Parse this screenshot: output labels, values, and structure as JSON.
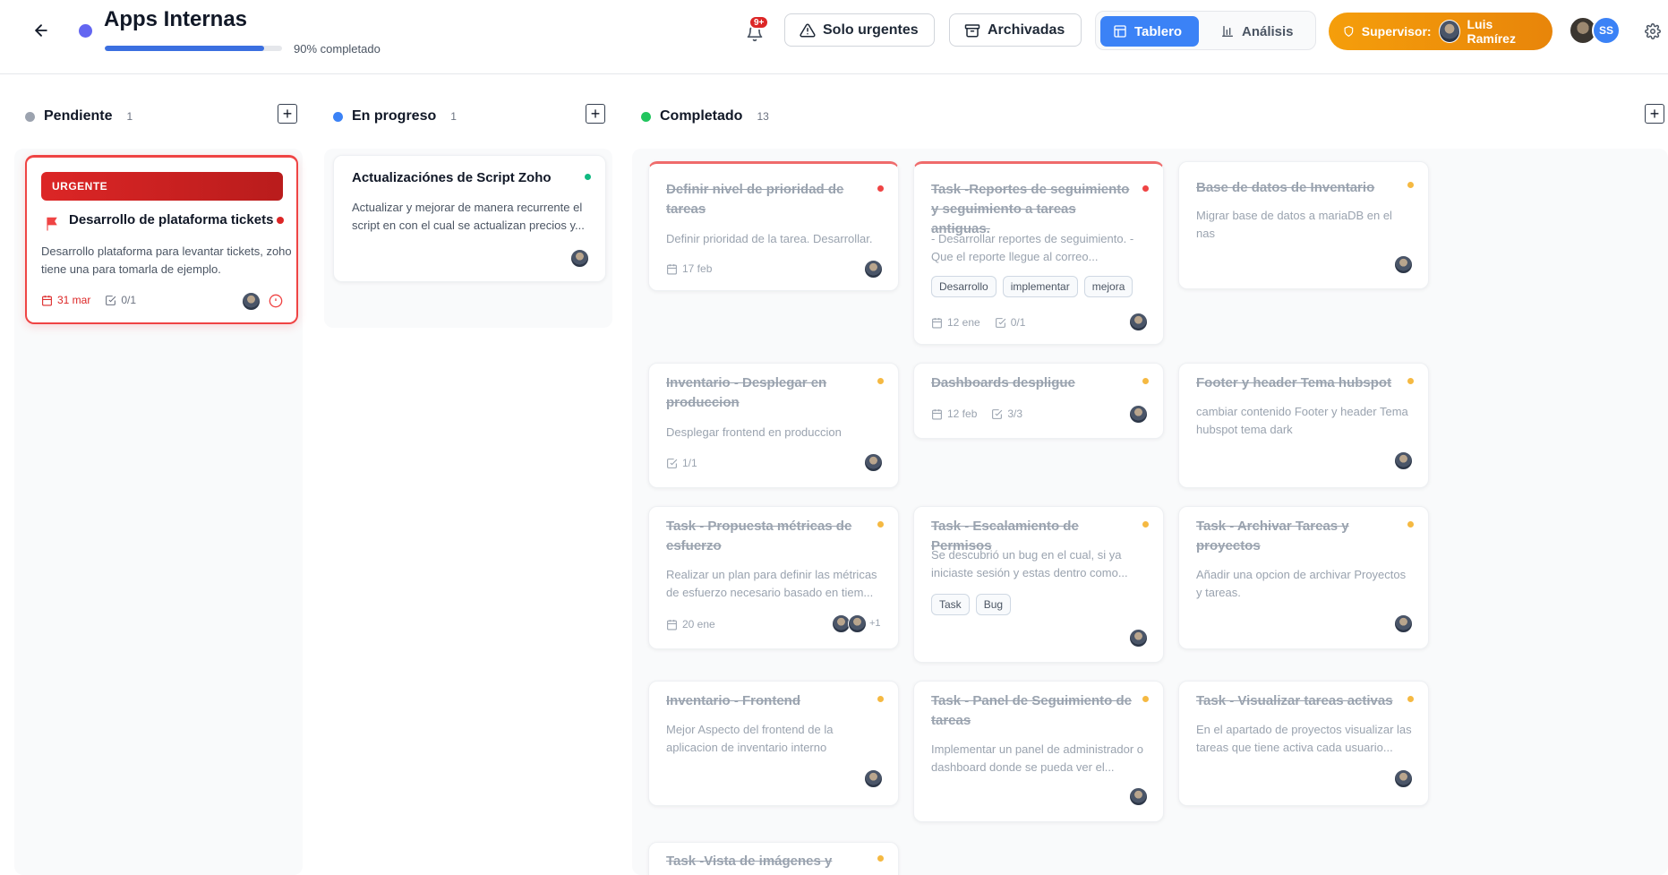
{
  "header": {
    "project_title": "Apps Internas",
    "project_color": "#6366f1",
    "progress_text": "90% completado",
    "progress_value": 0.9,
    "notifications_badge": "9+",
    "urgent_only_label": "Solo urgentes",
    "archived_label": "Archivadas",
    "view_board_label": "Tablero",
    "view_analysis_label": "Análisis",
    "supervisor_label": "Supervisor:",
    "supervisor_name": "Luis Ramírez",
    "team_initials": "SS"
  },
  "columns": {
    "pending": {
      "title": "Pendiente",
      "count": "1",
      "color": "#9ca3af"
    },
    "in_progress": {
      "title": "En progreso",
      "count": "1",
      "color": "#3b82f6"
    },
    "completed": {
      "title": "Completado",
      "count": "13",
      "color": "#22c55e"
    }
  },
  "pending_cards": [
    {
      "badge": "URGENTE",
      "title": "Desarrollo de plataforma tickets",
      "description": "Desarrollo plataforma para levantar tickets, zoho tiene una para tomarla de ejemplo.",
      "date": "31 mar",
      "checklist": "0/1"
    }
  ],
  "in_progress_cards": [
    {
      "title": "Actualizaciónes de Script Zoho",
      "description": "Actualizar y mejorar de manera recurrente el script en con el cual se actualizan precios y..."
    }
  ],
  "completed_cards": [
    {
      "title": "Definir nivel de prioridad de tareas",
      "description": "Definir prioridad de la tarea. Desarrollar.",
      "date": "17 feb"
    },
    {
      "title": "Task -Reportes de seguimiento y seguimiento a tareas antiguas.",
      "description": "- Desarrollar reportes de seguimiento. - Que el reporte llegue al correo...",
      "tags": [
        "Desarrollo",
        "implementar",
        "mejora"
      ],
      "date": "12 ene",
      "checklist": "0/1"
    },
    {
      "title": "Base de datos de Inventario",
      "description": "Migrar base de datos a mariaDB en el nas"
    },
    {
      "title": "Inventario - Desplegar en produccion",
      "description": "Desplegar frontend en produccion",
      "checklist": "1/1"
    },
    {
      "title": "Dashboards despligue",
      "date": "12 feb",
      "checklist": "3/3"
    },
    {
      "title": "Footer y header Tema hubspot",
      "description": "cambiar contenido Footer y header Tema hubspot tema dark"
    },
    {
      "title": "Task - Propuesta métricas de esfuerzo",
      "description": "Realizar un plan para definir las métricas de esfuerzo necesario basado en tiem...",
      "date": "20 ene",
      "extra_assignees": "+1"
    },
    {
      "title": "Task - Escalamiento de Permisos",
      "description": "Se descubrió un bug en el cual, si ya iniciaste sesión y estas dentro como...",
      "tags": [
        "Task",
        "Bug"
      ]
    },
    {
      "title": "Task - Archivar Tareas y proyectos",
      "description": "Añadir una opcion de archivar Proyectos y tareas."
    },
    {
      "title": "Inventario - Frontend",
      "description": "Mejor Aspecto del frontend de la aplicacion de inventario interno"
    },
    {
      "title": "Task - Panel de Seguimiento de tareas",
      "description": "Implementar un panel de administrador o dashboard donde se pueda ver el..."
    },
    {
      "title": "Task - Visualizar tareas activas",
      "description": "En el apartado de proyectos visualizar las tareas que tiene activa cada usuario..."
    },
    {
      "title": "Task -Vista de imágenes y"
    }
  ]
}
